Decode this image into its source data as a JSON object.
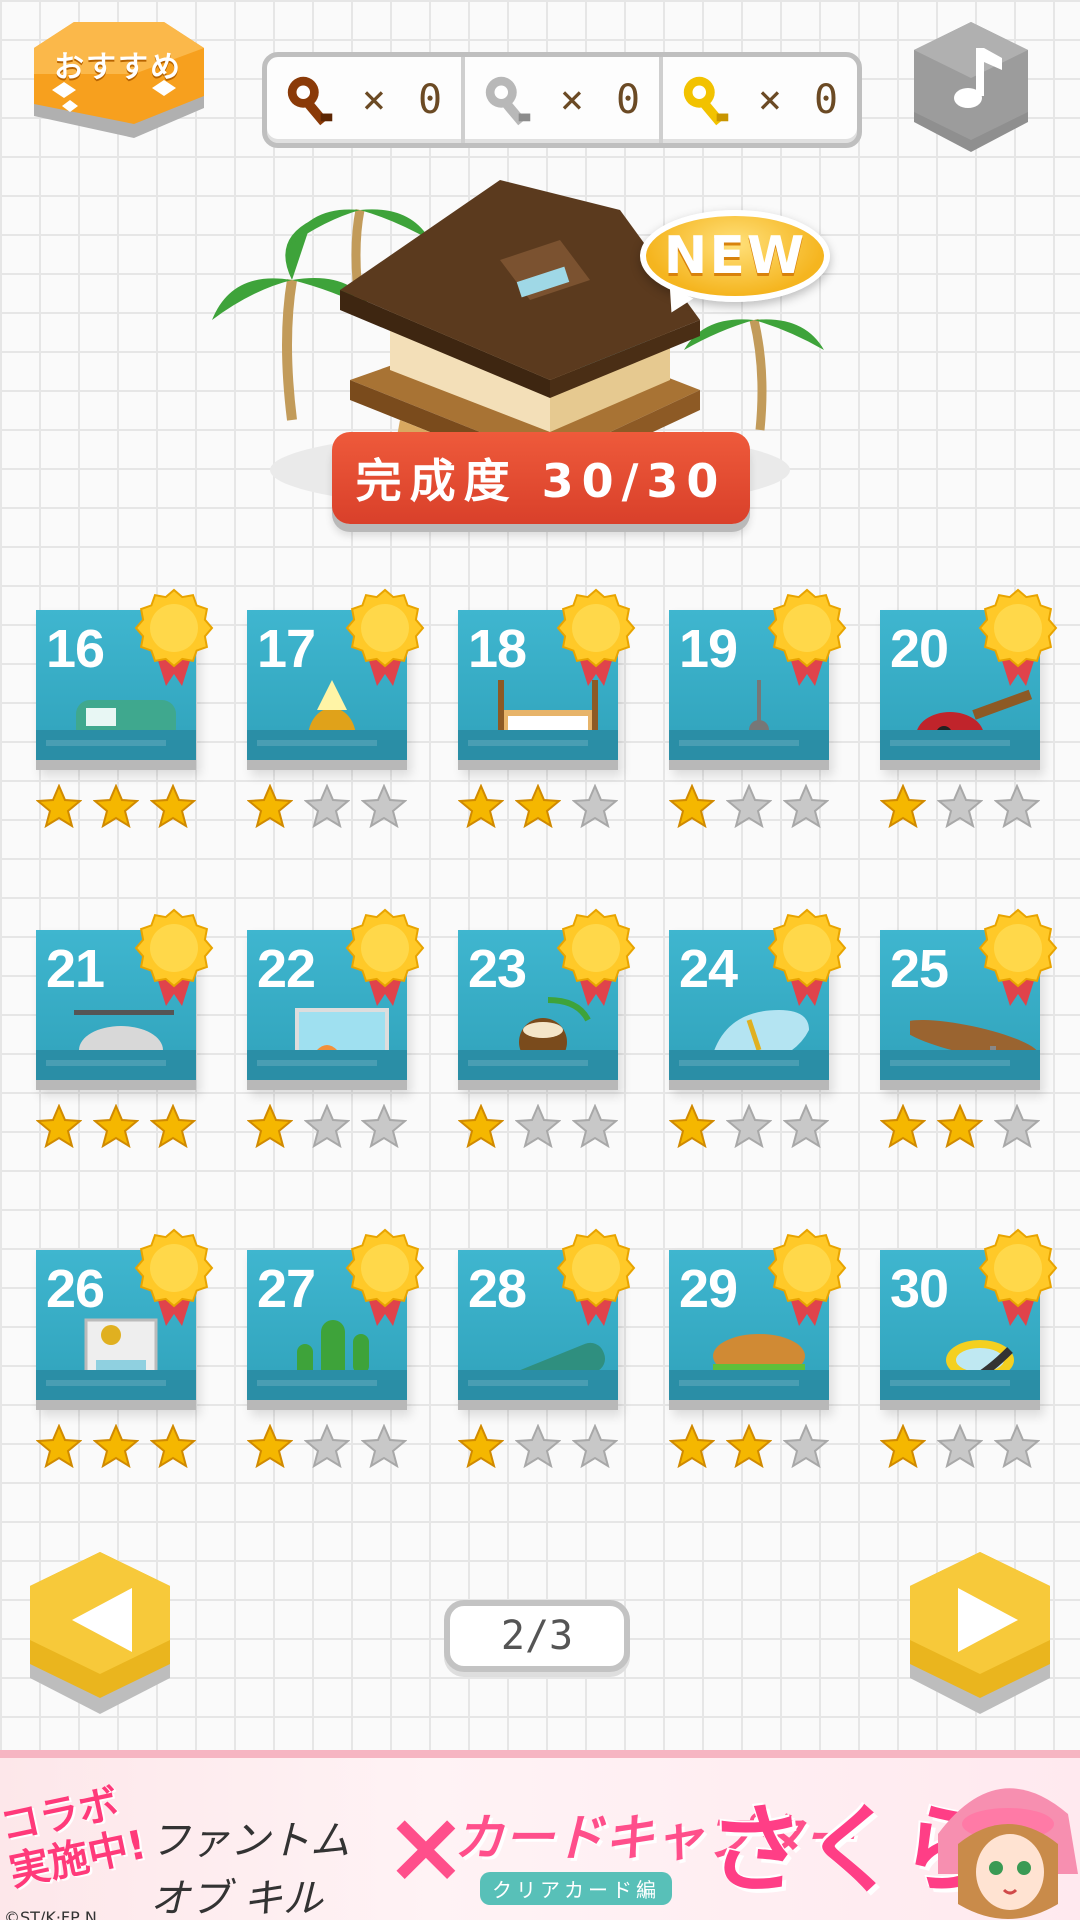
{
  "header": {
    "recommend_label": "おすすめ",
    "keys": [
      {
        "type": "bronze",
        "icon": "bronze-key-icon",
        "color": "#8a3a08",
        "count": "× 0"
      },
      {
        "type": "silver",
        "icon": "silver-key-icon",
        "color": "#b8b8b8",
        "count": "× 0"
      },
      {
        "type": "gold",
        "icon": "gold-key-icon",
        "color": "#f2c200",
        "count": "× 0"
      }
    ],
    "music_icon": "music-note-icon"
  },
  "hero": {
    "new_badge": "NEW",
    "completion_label": "完成度 30/30"
  },
  "levels": [
    {
      "num": "16",
      "item": "camper-van",
      "stars": 3
    },
    {
      "num": "17",
      "item": "pineapple-lamp",
      "stars": 1
    },
    {
      "num": "18",
      "item": "canopy-bed",
      "stars": 2
    },
    {
      "num": "19",
      "item": "ceiling-fan",
      "stars": 1
    },
    {
      "num": "20",
      "item": "ukulele",
      "stars": 1
    },
    {
      "num": "21",
      "item": "helicopter",
      "stars": 3
    },
    {
      "num": "22",
      "item": "aquarium",
      "stars": 1
    },
    {
      "num": "23",
      "item": "coconut-drink",
      "stars": 1
    },
    {
      "num": "24",
      "item": "sandal",
      "stars": 1
    },
    {
      "num": "25",
      "item": "surfboard",
      "stars": 2
    },
    {
      "num": "26",
      "item": "vending-machine",
      "stars": 3
    },
    {
      "num": "27",
      "item": "cactus",
      "stars": 1
    },
    {
      "num": "28",
      "item": "bottle",
      "stars": 1
    },
    {
      "num": "29",
      "item": "hamburger",
      "stars": 2
    },
    {
      "num": "30",
      "item": "snorkel",
      "stars": 1
    }
  ],
  "pager": {
    "label": "2/3"
  },
  "ad": {
    "collab": "コラボ実施中!",
    "game_title": "ファントム オブ キル",
    "cross": "×",
    "card_captor": "カードキャプター",
    "clear_card": "クリアカード編",
    "sakura": "さくら",
    "copyright": "©ST/K·FP N"
  },
  "colors": {
    "tile": "#38abc4",
    "medal": "#ffc928",
    "star_on": "#f5b700",
    "star_off": "#c8c8c8",
    "progress": "#e24b30",
    "nav": "#f5c226"
  }
}
